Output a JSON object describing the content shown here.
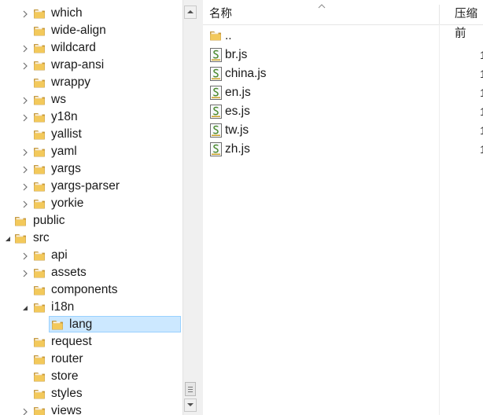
{
  "tree": {
    "items": [
      {
        "label": "which",
        "level": 1,
        "expander": "collapsed"
      },
      {
        "label": "wide-align",
        "level": 1,
        "expander": "none"
      },
      {
        "label": "wildcard",
        "level": 1,
        "expander": "collapsed"
      },
      {
        "label": "wrap-ansi",
        "level": 1,
        "expander": "collapsed"
      },
      {
        "label": "wrappy",
        "level": 1,
        "expander": "none"
      },
      {
        "label": "ws",
        "level": 1,
        "expander": "collapsed"
      },
      {
        "label": "y18n",
        "level": 1,
        "expander": "collapsed"
      },
      {
        "label": "yallist",
        "level": 1,
        "expander": "none"
      },
      {
        "label": "yaml",
        "level": 1,
        "expander": "collapsed"
      },
      {
        "label": "yargs",
        "level": 1,
        "expander": "collapsed"
      },
      {
        "label": "yargs-parser",
        "level": 1,
        "expander": "collapsed"
      },
      {
        "label": "yorkie",
        "level": 1,
        "expander": "collapsed"
      },
      {
        "label": "public",
        "level": 0,
        "expander": "none"
      },
      {
        "label": "src",
        "level": 0,
        "expander": "expanded"
      },
      {
        "label": "api",
        "level": 1,
        "expander": "collapsed"
      },
      {
        "label": "assets",
        "level": 1,
        "expander": "collapsed"
      },
      {
        "label": "components",
        "level": 1,
        "expander": "none"
      },
      {
        "label": "i18n",
        "level": 1,
        "expander": "expanded"
      },
      {
        "label": "lang",
        "level": 2,
        "expander": "none",
        "selected": true
      },
      {
        "label": "request",
        "level": 1,
        "expander": "none"
      },
      {
        "label": "router",
        "level": 1,
        "expander": "none"
      },
      {
        "label": "store",
        "level": 1,
        "expander": "none"
      },
      {
        "label": "styles",
        "level": 1,
        "expander": "none"
      },
      {
        "label": "views",
        "level": 1,
        "expander": "collapsed"
      }
    ]
  },
  "columns": {
    "name": "名称",
    "compressed": "压缩前"
  },
  "files": [
    {
      "name": "..",
      "type": "folder",
      "tail": ""
    },
    {
      "name": "br.js",
      "type": "js",
      "tail": "1"
    },
    {
      "name": "china.js",
      "type": "js",
      "tail": "1"
    },
    {
      "name": "en.js",
      "type": "js",
      "tail": "1"
    },
    {
      "name": "es.js",
      "type": "js",
      "tail": "1"
    },
    {
      "name": "tw.js",
      "type": "js",
      "tail": "1"
    },
    {
      "name": "zh.js",
      "type": "js",
      "tail": "1"
    }
  ],
  "colors": {
    "folder": "#e8b94a",
    "selection": "#cce8ff",
    "selection_border": "#99d1ff"
  },
  "icons": {
    "folder": "folder-icon",
    "js_file": "js-file-icon",
    "tree_collapsed": "tree-expand-icon",
    "tree_expanded": "tree-collapse-icon",
    "scroll_up": "scroll-up-icon",
    "scroll_down": "scroll-down-icon",
    "sort": "sort-ascending-icon"
  }
}
